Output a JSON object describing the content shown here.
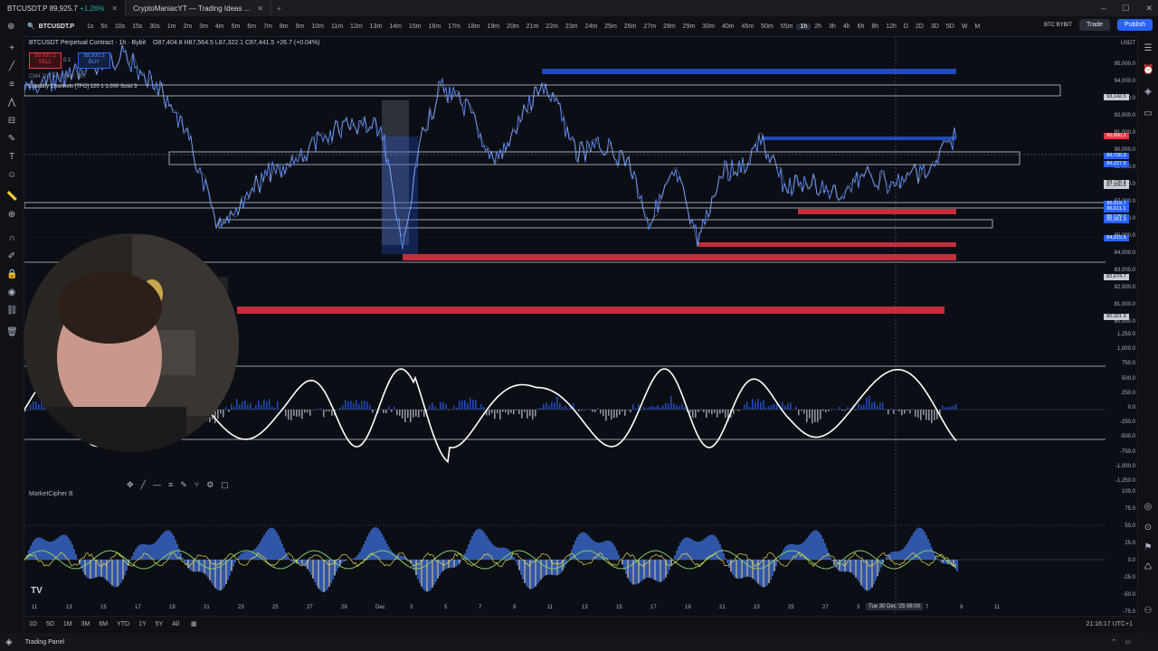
{
  "tabs": [
    {
      "label": "BTCUSDT.P",
      "price": "89,925.7",
      "change": "+1.26%"
    },
    {
      "label": "CryptoManiacYT — Trading Ideas ..."
    }
  ],
  "window_controls": {
    "minimize": "–",
    "maximize": "☐",
    "close": "✕"
  },
  "toolbar": {
    "symbol": "BTCUSDT.P",
    "timeframes": [
      "1s",
      "5s",
      "10s",
      "15s",
      "30s",
      "1m",
      "2m",
      "3m",
      "4m",
      "5m",
      "6m",
      "7m",
      "8m",
      "9m",
      "10m",
      "11m",
      "12m",
      "13m",
      "14m",
      "15m",
      "16m",
      "17m",
      "18m",
      "19m",
      "20m",
      "21m",
      "22m",
      "23m",
      "24m",
      "25m",
      "26m",
      "27m",
      "28m",
      "29m",
      "30m",
      "40m",
      "45m",
      "50m",
      "55m",
      "1h",
      "2h",
      "3h",
      "4h",
      "6h",
      "8h",
      "12h",
      "D",
      "2D",
      "3D",
      "5D",
      "W",
      "M"
    ],
    "selected_tf": "1h",
    "broker": "BTC BYBIT",
    "trade": "Trade",
    "publish": "Publish"
  },
  "legend": {
    "title": "BTCUSDT Perpetual Contract · 1h · Bybit",
    "ohlc": "O87,404.8 H87,564.5 L87,322.1 C87,441.5 +26.7 (+0.04%)",
    "sell_price": "89,930.2",
    "sell_label": "SELL",
    "spread": "0.1",
    "buy_price": "89,930.3",
    "buy_label": "BUY",
    "sublabel": "CM4 20 / 50 / 100 / 200",
    "indicator": "Liquidity Channels [TFO] 120 1 1,000 Solid 3"
  },
  "indicator2": "MarketCipher B",
  "price_scale": {
    "currency": "USDT",
    "prices": [
      "95,000.0",
      "94,000.0",
      "93,000.0",
      "92,000.0",
      "91,000.0",
      "90,000.0",
      "89,000.0",
      "88,000.0",
      "87,000.0",
      "86,000.0",
      "85,000.0",
      "84,000.0",
      "83,000.0",
      "82,000.0",
      "81,000.0",
      "80,000.0"
    ],
    "tags": [
      {
        "text": "93,142.5",
        "color": "#c9ccd3"
      },
      {
        "text": "90,860.3",
        "color": "#f23645"
      },
      {
        "text": "89,720.3",
        "color": "#2962ff"
      },
      {
        "text": "89,227.5",
        "color": "#2962ff"
      },
      {
        "text": "88,138.4",
        "color": "#c9ccd3"
      },
      {
        "text": "87,950.8",
        "color": "#c9ccd3"
      },
      {
        "text": "86,919.7",
        "color": "#2962ff"
      },
      {
        "text": "86,611.1",
        "color": "#2962ff"
      },
      {
        "text": "86,129.7",
        "color": "#2962ff"
      },
      {
        "text": "85,961.3",
        "color": "#2962ff"
      },
      {
        "text": "84,915.9",
        "color": "#2962ff"
      },
      {
        "text": "82,674.7",
        "color": "#c9ccd3"
      },
      {
        "text": "80,321.9",
        "color": "#c9ccd3"
      }
    ],
    "osc1": [
      "1,250.0",
      "1,000.0",
      "750.0",
      "500.0",
      "250.0",
      "0.0",
      "-250.0",
      "-500.0",
      "-750.0",
      "-1,000.0",
      "-1,250.0"
    ],
    "osc2": [
      "100.0",
      "75.0",
      "50.0",
      "25.0",
      "0.0",
      "-25.0",
      "-50.0",
      "-75.0"
    ]
  },
  "time_axis": [
    "11",
    "13",
    "15",
    "17",
    "19",
    "21",
    "23",
    "25",
    "27",
    "29",
    "Dec",
    "3",
    "5",
    "7",
    "9",
    "11",
    "13",
    "15",
    "17",
    "19",
    "21",
    "23",
    "25",
    "27",
    "3",
    "5",
    "7",
    "9",
    "11"
  ],
  "crosshair_time": "Tue 30 Dec '25  08:00",
  "bottom": {
    "ranges": [
      "1D",
      "5D",
      "1M",
      "3M",
      "6M",
      "YTD",
      "1Y",
      "5Y",
      "All"
    ],
    "clock": "21:16:17 UTC+1"
  },
  "status": {
    "trading_panel": "Trading Panel"
  },
  "colors": {
    "bg": "#0b0e14",
    "blue": "#2962ff",
    "red": "#f23645",
    "white": "#ffffff"
  }
}
